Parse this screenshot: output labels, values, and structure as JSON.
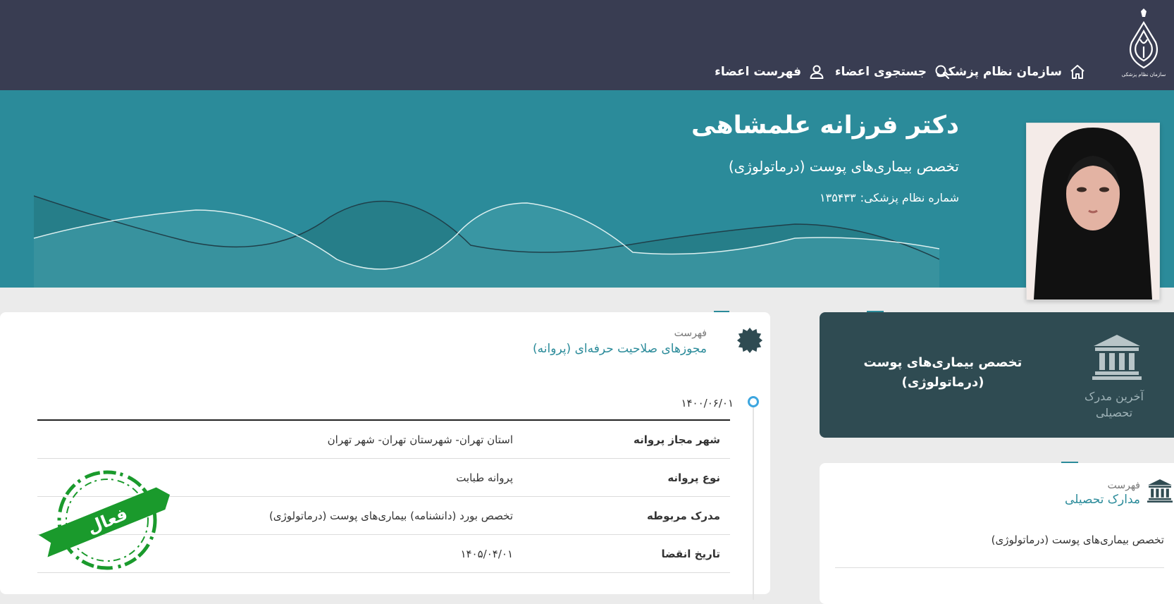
{
  "nav": {
    "items": [
      {
        "label": "سازمان نظام پزشکی",
        "icon": "home-icon"
      },
      {
        "label": "جستجوی اعضاء",
        "icon": "search-icon"
      },
      {
        "label": "فهرست اعضاء",
        "icon": "user-icon"
      }
    ]
  },
  "profile": {
    "name": "دکتر فرزانه علمشاهی",
    "specialty": "تخصص بیماری‌های پوست (درماتولوژی)",
    "number_label": "شماره نظام پزشکی:",
    "number_value": "۱۳۵۴۳۳"
  },
  "licenses": {
    "subtitle": "فهرست",
    "title": "مجوزهای صلاحیت حرفه‌ای (پروانه)",
    "date": "۱۴۰۰/۰۶/۰۱",
    "rows": [
      {
        "key": "شهر مجاز پروانه",
        "value": "استان تهران- شهرستان تهران- شهر تهران"
      },
      {
        "key": "نوع پروانه",
        "value": "پروانه طبابت"
      },
      {
        "key": "مدرک مربوطه",
        "value": "تخصص بورد (دانشنامه) بیماری‌های پوست (درماتولوژی)"
      },
      {
        "key": "تاریخ انقضا",
        "value": "۱۴۰۵/۰۴/۰۱"
      }
    ],
    "status_stamp": "فعال"
  },
  "last_degree": {
    "label": "آخرین مدرک تحصیلی",
    "title": "تخصص بیماری‌های پوست (درماتولوژی)"
  },
  "education": {
    "subtitle": "فهرست",
    "title": "مدارک تحصیلی",
    "items": [
      "تخصص بیماری‌های پوست (درماتولوژی)"
    ]
  },
  "colors": {
    "nav_bg": "#393d52",
    "hero_bg": "#2b8b9a",
    "accent": "#2b8b9a",
    "degree_card_bg": "#2f4b52",
    "stamp_green": "#1a9a2c"
  }
}
